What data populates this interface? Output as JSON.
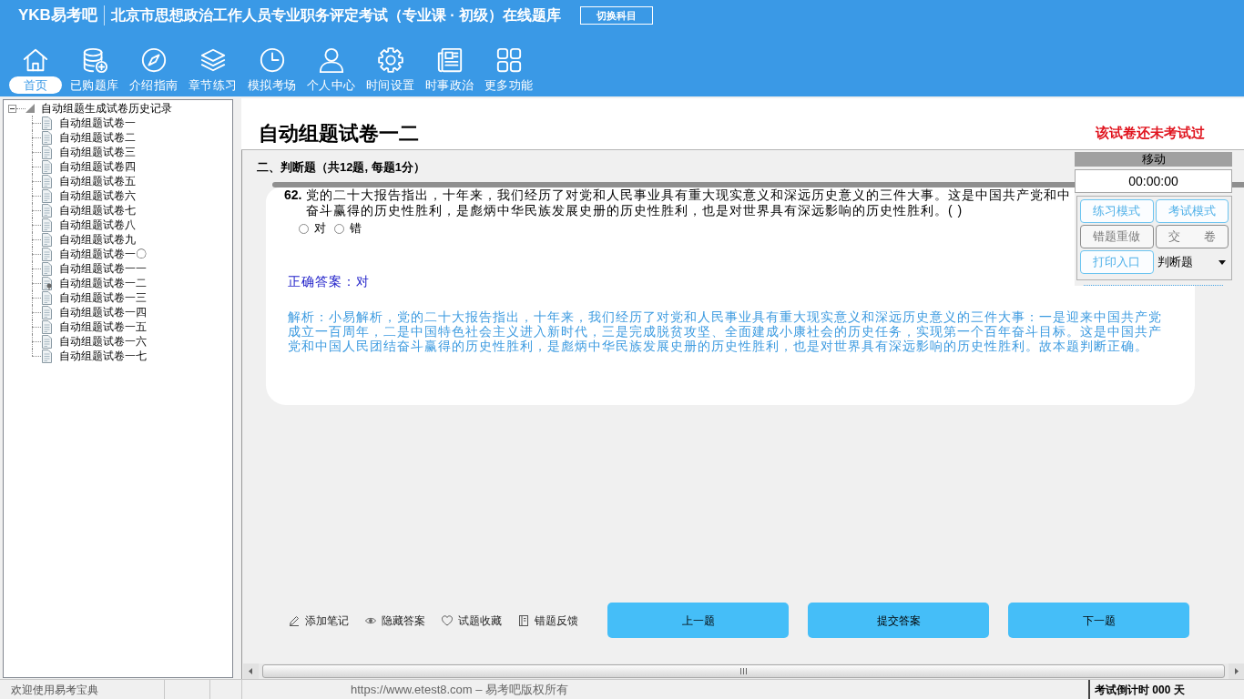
{
  "header": {
    "logo": "YKB易考吧",
    "title": "北京市思想政治工作人员专业职务评定考试（专业课 · 初级）在线题库",
    "switch_button": "切换科目"
  },
  "toolbar": [
    {
      "label": "首页",
      "selected": true
    },
    {
      "label": "已购题库",
      "selected": false
    },
    {
      "label": "介绍指南",
      "selected": false
    },
    {
      "label": "章节练习",
      "selected": false
    },
    {
      "label": "模拟考场",
      "selected": false
    },
    {
      "label": "个人中心",
      "selected": false
    },
    {
      "label": "时间设置",
      "selected": false
    },
    {
      "label": "时事政治",
      "selected": false
    },
    {
      "label": "更多功能",
      "selected": false
    }
  ],
  "tree": {
    "label": "自动组题生成试卷历史记录",
    "expanded": true,
    "children": [
      {
        "label": "自动组题试卷一",
        "current": false
      },
      {
        "label": "自动组题试卷二",
        "current": false
      },
      {
        "label": "自动组题试卷三",
        "current": false
      },
      {
        "label": "自动组题试卷四",
        "current": false
      },
      {
        "label": "自动组题试卷五",
        "current": false
      },
      {
        "label": "自动组题试卷六",
        "current": false
      },
      {
        "label": "自动组题试卷七",
        "current": false
      },
      {
        "label": "自动组题试卷八",
        "current": false
      },
      {
        "label": "自动组题试卷九",
        "current": false
      },
      {
        "label": "自动组题试卷一〇",
        "current": false
      },
      {
        "label": "自动组题试卷一一",
        "current": false
      },
      {
        "label": "自动组题试卷一二",
        "current": true
      },
      {
        "label": "自动组题试卷一三",
        "current": false
      },
      {
        "label": "自动组题试卷一四",
        "current": false
      },
      {
        "label": "自动组题试卷一五",
        "current": false
      },
      {
        "label": "自动组题试卷一六",
        "current": false
      },
      {
        "label": "自动组题试卷一七",
        "current": false
      }
    ]
  },
  "paper": {
    "title": "自动组题试卷一二",
    "status": "该试卷还未考试过"
  },
  "section": {
    "heading": "二、判断题（共12题, 每题1分）"
  },
  "question": {
    "number": "62.",
    "lines": [
      "党的二十大报告指出，十年来，我们经历了对党和人民事业具有重大现实意义和深远历史意义的三件大事。这是中国共产党和中",
      "奋斗赢得的历史性胜利，是彪炳中华民族发展史册的历史性胜利，也是对世界具有深远影响的历史性胜利。( )"
    ],
    "options": [
      {
        "label": "对",
        "checked": false
      },
      {
        "label": "错",
        "checked": false
      }
    ],
    "answer": "正确答案：对",
    "explanation": "解析：小易解析，党的二十大报告指出，十年来，我们经历了对党和人民事业具有重大现实意义和深远历史意义的三件大事：一是迎来中国共产党成立一百周年，二是中国特色社会主义进入新时代，三是完成脱贫攻坚、全面建成小康社会的历史任务，实现第一个百年奋斗目标。这是中国共产党和中国人民团结奋斗赢得的历史性胜利，是彪炳中华民族发展史册的历史性胜利，也是对世界具有深远影响的历史性胜利。故本题判断正确。"
  },
  "float_panel": {
    "title": "移动",
    "timer": "00:00:00",
    "buttons": [
      {
        "label": "练习模式",
        "disabled": false
      },
      {
        "label": "考试模式",
        "disabled": false
      },
      {
        "label": "错题重做",
        "disabled": true
      },
      {
        "label": "交　　卷",
        "disabled": true
      },
      {
        "label": "打印入口",
        "disabled": false
      }
    ],
    "type_select": {
      "value": "判断题"
    }
  },
  "tools": [
    "添加笔记",
    "隐藏答案",
    "试题收藏",
    "错题反馈"
  ],
  "nav_buttons": [
    "上一题",
    "提交答案",
    "下一题"
  ],
  "status_bar": {
    "welcome": "欢迎使用易考宝典",
    "copyright": "https://www.etest8.com – 易考吧版权所有",
    "countdown": "考试倒计时 000 天"
  }
}
